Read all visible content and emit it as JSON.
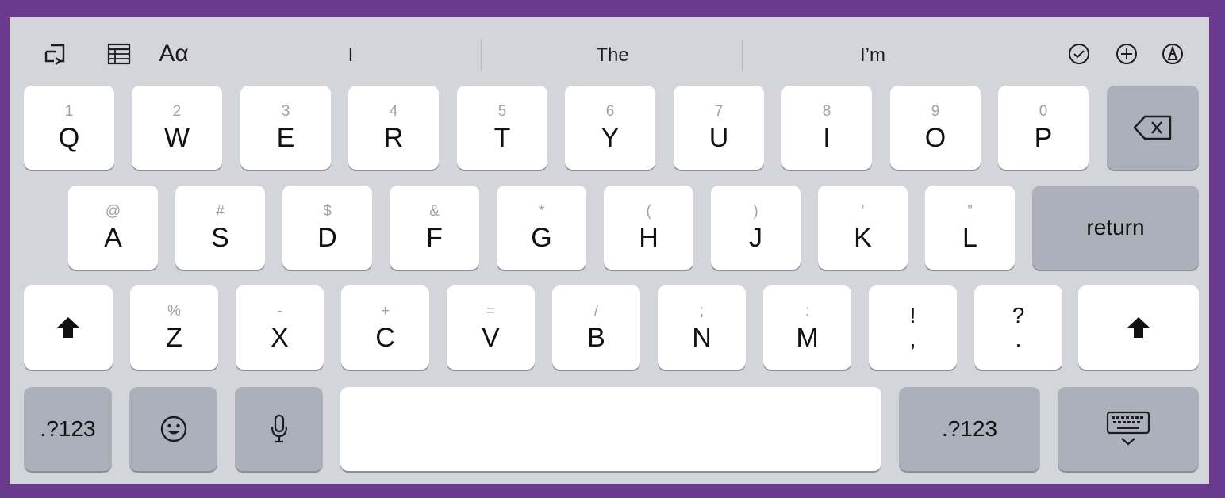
{
  "colors": {
    "frame": "#6a3a8e",
    "keyboard_bg": "#d3d5da",
    "key_light": "#ffffff",
    "key_dark": "#abb0ba",
    "secondary_text": "#9ea1a6"
  },
  "toolbar": {
    "left_icons": [
      "undo-icon",
      "table-icon"
    ],
    "format_label": "Aα",
    "suggestions": [
      "I",
      "The",
      "I’m"
    ],
    "right_icons": [
      "checkmark-circle-icon",
      "plus-circle-icon",
      "markup-pen-icon"
    ]
  },
  "rows": {
    "row1": [
      {
        "pri": "Q",
        "sec": "1"
      },
      {
        "pri": "W",
        "sec": "2"
      },
      {
        "pri": "E",
        "sec": "3"
      },
      {
        "pri": "R",
        "sec": "4"
      },
      {
        "pri": "T",
        "sec": "5"
      },
      {
        "pri": "Y",
        "sec": "6"
      },
      {
        "pri": "U",
        "sec": "7"
      },
      {
        "pri": "I",
        "sec": "8"
      },
      {
        "pri": "O",
        "sec": "9"
      },
      {
        "pri": "P",
        "sec": "0"
      }
    ],
    "row2": [
      {
        "pri": "A",
        "sec": "@"
      },
      {
        "pri": "S",
        "sec": "#"
      },
      {
        "pri": "D",
        "sec": "$"
      },
      {
        "pri": "F",
        "sec": "&"
      },
      {
        "pri": "G",
        "sec": "*"
      },
      {
        "pri": "H",
        "sec": "("
      },
      {
        "pri": "J",
        "sec": ")"
      },
      {
        "pri": "K",
        "sec": "’"
      },
      {
        "pri": "L",
        "sec": "”"
      }
    ],
    "row3": [
      {
        "pri": "Z",
        "sec": "%"
      },
      {
        "pri": "X",
        "sec": "-"
      },
      {
        "pri": "C",
        "sec": "+"
      },
      {
        "pri": "V",
        "sec": "="
      },
      {
        "pri": "B",
        "sec": "/"
      },
      {
        "pri": "N",
        "sec": ";"
      },
      {
        "pri": "M",
        "sec": ":"
      }
    ],
    "punct": [
      {
        "top": "!",
        "bottom": ","
      },
      {
        "top": "?",
        "bottom": "."
      }
    ]
  },
  "special_keys": {
    "return_label": "return",
    "numbers_left_label": ".?123",
    "numbers_right_label": ".?123",
    "delete_icon": "delete-backspace-icon",
    "shift_icon": "shift-arrow-icon",
    "emoji_icon": "emoji-smiley-icon",
    "mic_icon": "microphone-icon",
    "dismiss_icon": "keyboard-dismiss-icon"
  }
}
